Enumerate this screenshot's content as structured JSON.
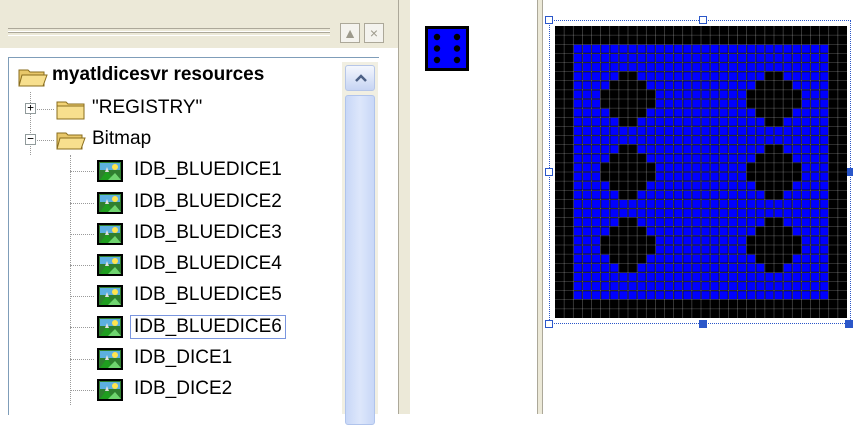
{
  "header": {
    "minimize_label": "▲",
    "close_label": "×"
  },
  "tree": {
    "root": {
      "label": "myatldicesvr resources",
      "icon": "folder-open-icon"
    },
    "nodes": [
      {
        "label": "\"REGISTRY\"",
        "icon": "folder-closed-icon",
        "expander": "+",
        "kind": "folder"
      },
      {
        "label": "Bitmap",
        "icon": "folder-open-icon",
        "expander": "−",
        "kind": "folder"
      },
      {
        "label": "IDB_BLUEDICE1",
        "icon": "bitmap-icon",
        "kind": "bitmap"
      },
      {
        "label": "IDB_BLUEDICE2",
        "icon": "bitmap-icon",
        "kind": "bitmap"
      },
      {
        "label": "IDB_BLUEDICE3",
        "icon": "bitmap-icon",
        "kind": "bitmap"
      },
      {
        "label": "IDB_BLUEDICE4",
        "icon": "bitmap-icon",
        "kind": "bitmap"
      },
      {
        "label": "IDB_BLUEDICE5",
        "icon": "bitmap-icon",
        "kind": "bitmap"
      },
      {
        "label": "IDB_BLUEDICE6",
        "icon": "bitmap-icon",
        "kind": "bitmap",
        "selected": true
      },
      {
        "label": "IDB_DICE1",
        "icon": "bitmap-icon",
        "kind": "bitmap"
      },
      {
        "label": "IDB_DICE2",
        "icon": "bitmap-icon",
        "kind": "bitmap"
      }
    ]
  },
  "preview": {
    "face_value": 6,
    "die_color": "#0000ff",
    "pip_color": "#000000"
  },
  "editor": {
    "grid_cells": 32,
    "die_color": "#0000ff",
    "pip_color": "#000000",
    "border_color": "#000000",
    "grid_line_color": "#ffffff",
    "face_value": 6,
    "selection_color": "#2b57c9"
  }
}
